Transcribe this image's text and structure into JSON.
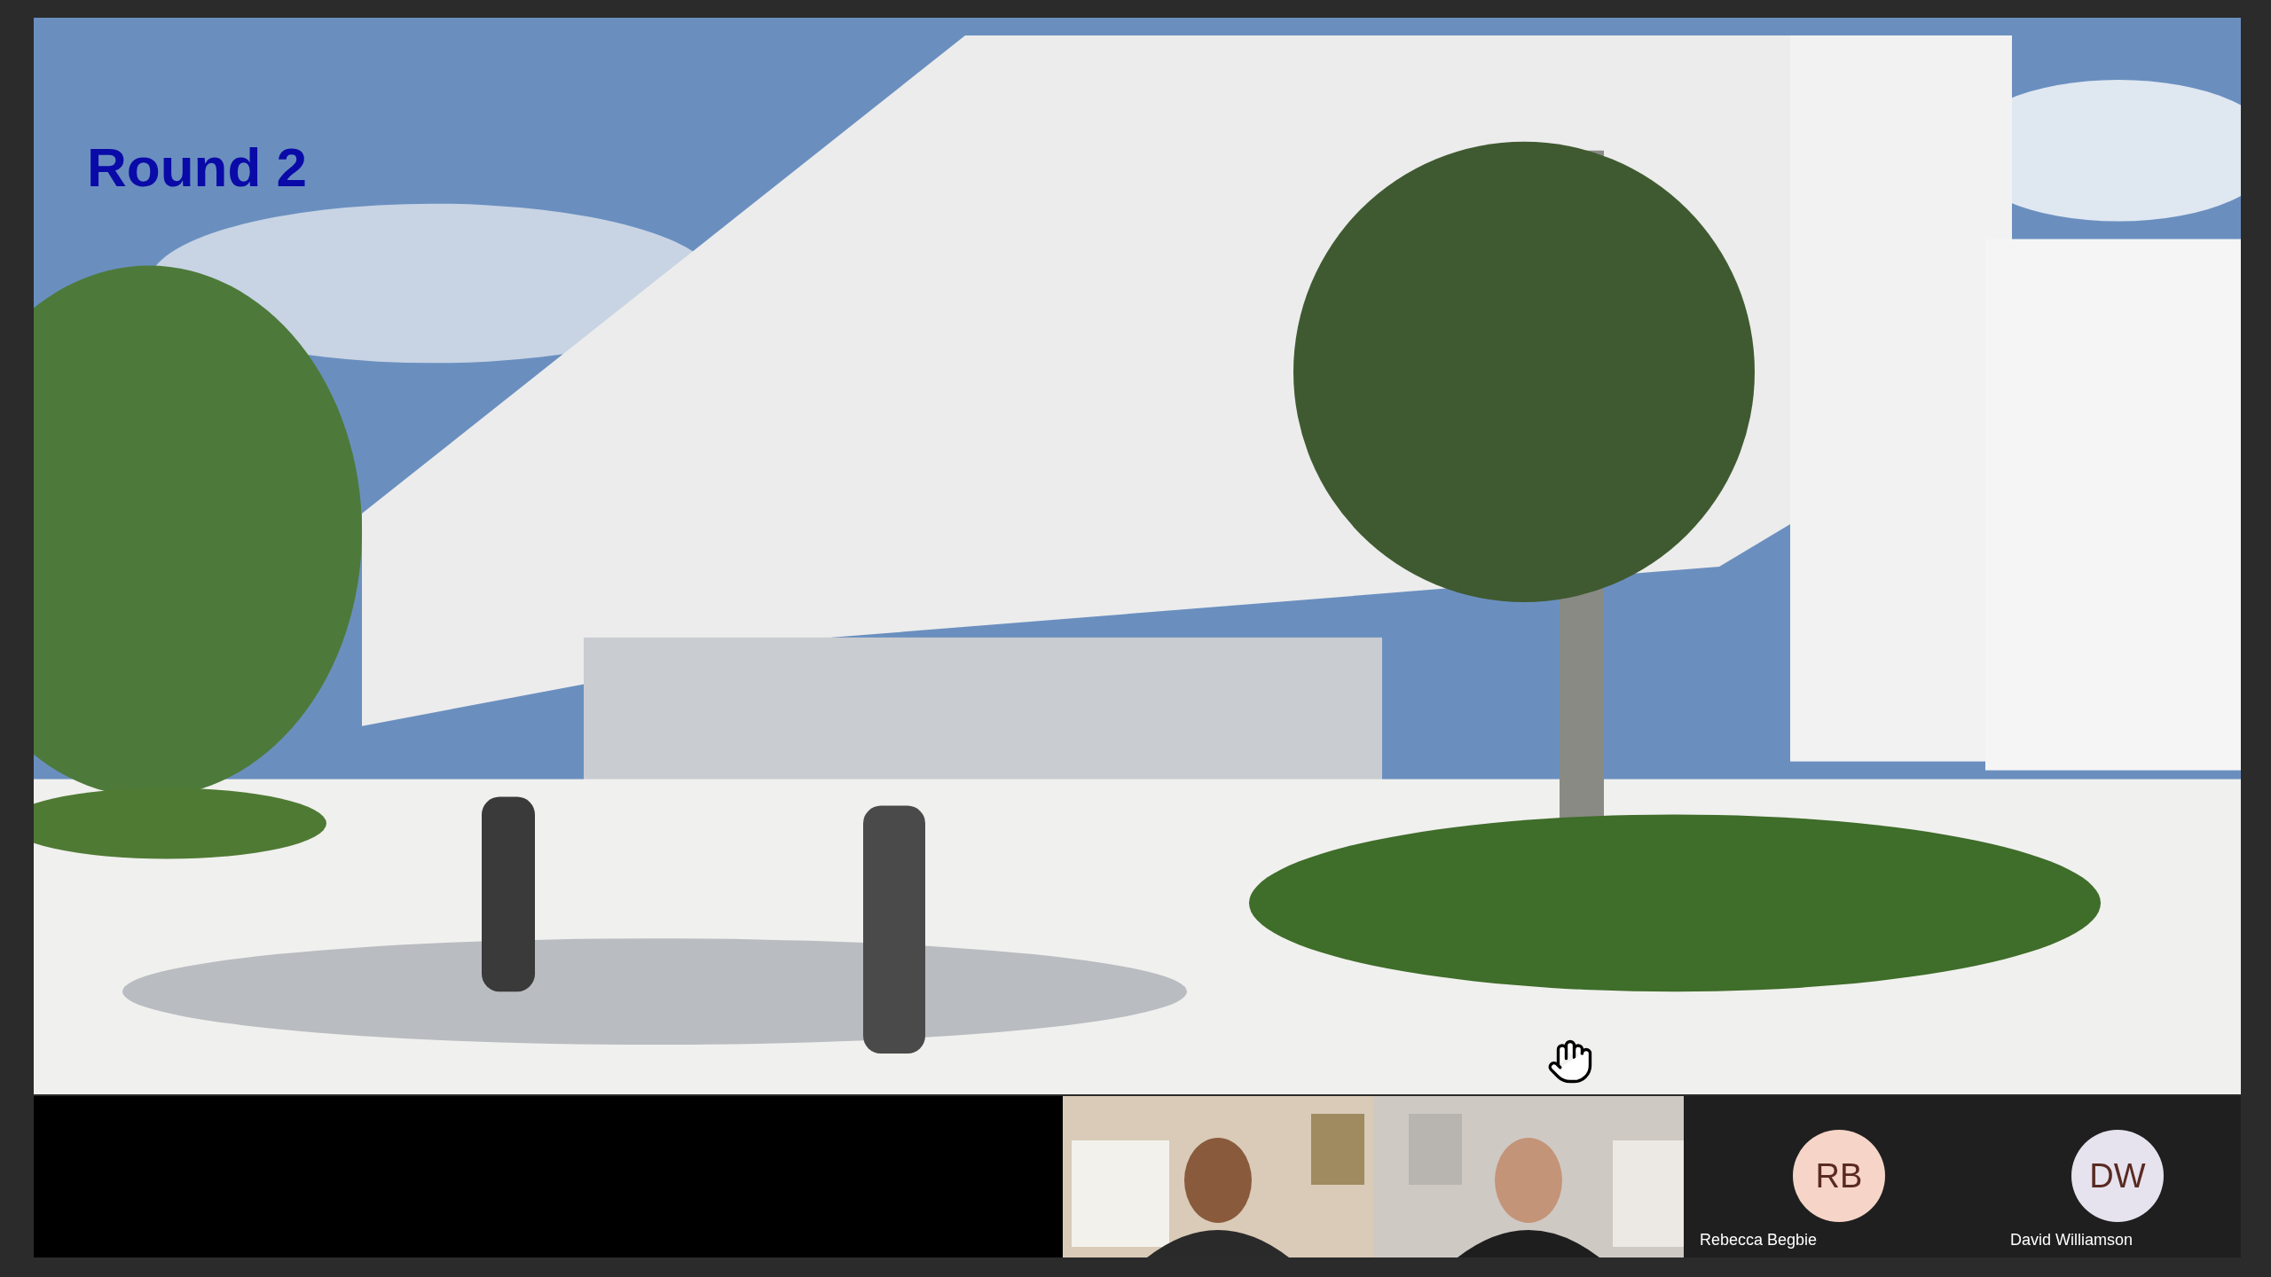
{
  "shared_screen": {
    "kind": "picture",
    "overlay_title": "Round 2"
  },
  "participants": [
    {
      "kind": "video"
    },
    {
      "kind": "video"
    },
    {
      "kind": "avatar",
      "initials": "RB",
      "name": "Rebecca Begbie",
      "color": "#f6d5c8"
    },
    {
      "kind": "avatar",
      "initials": "DW",
      "name": "David Williamson",
      "color": "#e6e3ee"
    }
  ]
}
